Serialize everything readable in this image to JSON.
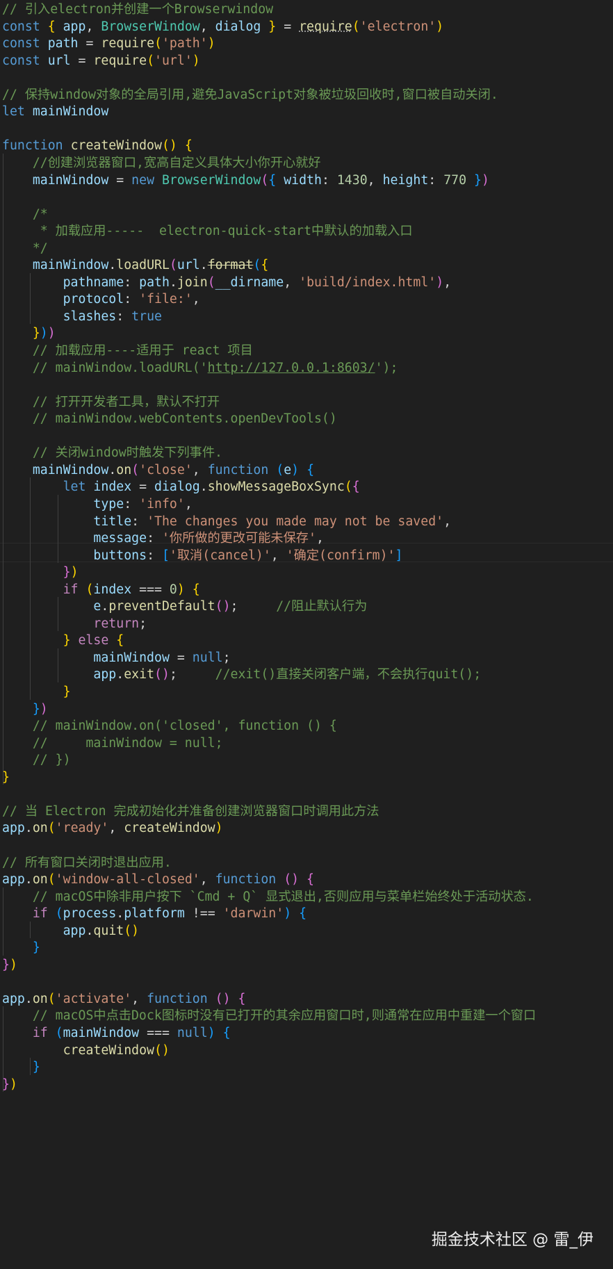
{
  "editor": {
    "background": "#1f1f1f",
    "lines": [
      [
        [
          "comment",
          "// 引入electron并创建一个Browserwindow"
        ]
      ],
      [
        [
          "keyword",
          "const"
        ],
        [
          "plain",
          " "
        ],
        [
          "b1",
          "{"
        ],
        [
          "plain",
          " "
        ],
        [
          "variable",
          "app"
        ],
        [
          "plain",
          ", "
        ],
        [
          "class",
          "BrowserWindow"
        ],
        [
          "plain",
          ", "
        ],
        [
          "variable",
          "dialog"
        ],
        [
          "plain",
          " "
        ],
        [
          "b1",
          "}"
        ],
        [
          "plain",
          " = "
        ],
        [
          "hint",
          "require"
        ],
        [
          "b1",
          "("
        ],
        [
          "string",
          "'electron'"
        ],
        [
          "b1",
          ")"
        ]
      ],
      [
        [
          "keyword",
          "const"
        ],
        [
          "plain",
          " "
        ],
        [
          "variable",
          "path"
        ],
        [
          "plain",
          " = "
        ],
        [
          "function",
          "require"
        ],
        [
          "b1",
          "("
        ],
        [
          "string",
          "'path'"
        ],
        [
          "b1",
          ")"
        ]
      ],
      [
        [
          "keyword",
          "const"
        ],
        [
          "plain",
          " "
        ],
        [
          "variable",
          "url"
        ],
        [
          "plain",
          " = "
        ],
        [
          "function",
          "require"
        ],
        [
          "b1",
          "("
        ],
        [
          "string",
          "'url'"
        ],
        [
          "b1",
          ")"
        ]
      ],
      [],
      [
        [
          "comment",
          "// 保持window对象的全局引用,避免JavaScript对象被垃圾回收时,窗口被自动关闭."
        ]
      ],
      [
        [
          "keyword",
          "let"
        ],
        [
          "plain",
          " "
        ],
        [
          "variable",
          "mainWindow"
        ]
      ],
      [],
      [
        [
          "keyword",
          "function"
        ],
        [
          "plain",
          " "
        ],
        [
          "function",
          "createWindow"
        ],
        [
          "b1",
          "()"
        ],
        [
          "plain",
          " "
        ],
        [
          "b1",
          "{"
        ]
      ],
      [
        [
          "plain",
          "    "
        ],
        [
          "comment",
          "//创建浏览器窗口,宽高自定义具体大小你开心就好"
        ]
      ],
      [
        [
          "plain",
          "    "
        ],
        [
          "variable",
          "mainWindow"
        ],
        [
          "plain",
          " = "
        ],
        [
          "keyword",
          "new"
        ],
        [
          "plain",
          " "
        ],
        [
          "class",
          "BrowserWindow"
        ],
        [
          "b2",
          "("
        ],
        [
          "b3",
          "{"
        ],
        [
          "plain",
          " "
        ],
        [
          "variable",
          "width"
        ],
        [
          "plain",
          ": "
        ],
        [
          "number",
          "1430"
        ],
        [
          "plain",
          ", "
        ],
        [
          "variable",
          "height"
        ],
        [
          "plain",
          ": "
        ],
        [
          "number",
          "770"
        ],
        [
          "plain",
          " "
        ],
        [
          "b3",
          "}"
        ],
        [
          "b2",
          ")"
        ]
      ],
      [],
      [
        [
          "plain",
          "    "
        ],
        [
          "comment",
          "/*"
        ]
      ],
      [
        [
          "plain",
          "    "
        ],
        [
          "comment",
          " * 加载应用-----  electron-quick-start中默认的加载入口"
        ]
      ],
      [
        [
          "plain",
          "    "
        ],
        [
          "comment",
          "*/"
        ]
      ],
      [
        [
          "plain",
          "    "
        ],
        [
          "variable",
          "mainWindow"
        ],
        [
          "plain",
          "."
        ],
        [
          "function",
          "loadURL"
        ],
        [
          "b2",
          "("
        ],
        [
          "variable",
          "url"
        ],
        [
          "plain",
          "."
        ],
        [
          "deprecated",
          "format"
        ],
        [
          "b3",
          "("
        ],
        [
          "b1",
          "{"
        ]
      ],
      [
        [
          "plain",
          "        "
        ],
        [
          "variable",
          "pathname"
        ],
        [
          "plain",
          ": "
        ],
        [
          "variable",
          "path"
        ],
        [
          "plain",
          "."
        ],
        [
          "function",
          "join"
        ],
        [
          "b2",
          "("
        ],
        [
          "variable",
          "__dirname"
        ],
        [
          "plain",
          ", "
        ],
        [
          "string",
          "'build/index.html'"
        ],
        [
          "b2",
          ")"
        ],
        [
          "plain",
          ","
        ]
      ],
      [
        [
          "plain",
          "        "
        ],
        [
          "variable",
          "protocol"
        ],
        [
          "plain",
          ": "
        ],
        [
          "string",
          "'file:'"
        ],
        [
          "plain",
          ","
        ]
      ],
      [
        [
          "plain",
          "        "
        ],
        [
          "variable",
          "slashes"
        ],
        [
          "plain",
          ": "
        ],
        [
          "keyword",
          "true"
        ]
      ],
      [
        [
          "plain",
          "    "
        ],
        [
          "b1",
          "}"
        ],
        [
          "b3",
          ")"
        ],
        [
          "b2",
          ")"
        ]
      ],
      [
        [
          "plain",
          "    "
        ],
        [
          "comment",
          "// 加载应用----适用于 react 项目"
        ]
      ],
      [
        [
          "plain",
          "    "
        ],
        [
          "comment",
          "// mainWindow.loadURL('"
        ],
        [
          "link",
          "http://127.0.0.1:8603/"
        ],
        [
          "comment",
          "');"
        ]
      ],
      [],
      [
        [
          "plain",
          "    "
        ],
        [
          "comment",
          "// 打开开发者工具，默认不打开"
        ]
      ],
      [
        [
          "plain",
          "    "
        ],
        [
          "comment",
          "// mainWindow.webContents.openDevTools()"
        ]
      ],
      [],
      [
        [
          "plain",
          "    "
        ],
        [
          "comment",
          "// 关闭window时触发下列事件."
        ]
      ],
      [
        [
          "plain",
          "    "
        ],
        [
          "variable",
          "mainWindow"
        ],
        [
          "plain",
          "."
        ],
        [
          "function",
          "on"
        ],
        [
          "b2",
          "("
        ],
        [
          "string",
          "'close'"
        ],
        [
          "plain",
          ", "
        ],
        [
          "keyword",
          "function"
        ],
        [
          "plain",
          " "
        ],
        [
          "b3",
          "("
        ],
        [
          "variable",
          "e"
        ],
        [
          "b3",
          ")"
        ],
        [
          "plain",
          " "
        ],
        [
          "b3",
          "{"
        ]
      ],
      [
        [
          "plain",
          "        "
        ],
        [
          "keyword",
          "let"
        ],
        [
          "plain",
          " "
        ],
        [
          "variable",
          "index"
        ],
        [
          "plain",
          " = "
        ],
        [
          "variable",
          "dialog"
        ],
        [
          "plain",
          "."
        ],
        [
          "function",
          "showMessageBoxSync"
        ],
        [
          "b1",
          "("
        ],
        [
          "b2",
          "{"
        ]
      ],
      [
        [
          "plain",
          "            "
        ],
        [
          "variable",
          "type"
        ],
        [
          "plain",
          ": "
        ],
        [
          "string",
          "'info'"
        ],
        [
          "plain",
          ","
        ]
      ],
      [
        [
          "plain",
          "            "
        ],
        [
          "variable",
          "title"
        ],
        [
          "plain",
          ": "
        ],
        [
          "string",
          "'The changes you made may not be saved'"
        ],
        [
          "plain",
          ","
        ]
      ],
      [
        [
          "plain",
          "            "
        ],
        [
          "variable",
          "message"
        ],
        [
          "plain",
          ": "
        ],
        [
          "string",
          "'你所做的更改可能未保存'"
        ],
        [
          "plain",
          ","
        ]
      ],
      [
        [
          "plain",
          "            "
        ],
        [
          "variable",
          "buttons"
        ],
        [
          "plain",
          ": "
        ],
        [
          "b3",
          "["
        ],
        [
          "string",
          "'取消(cancel)'"
        ],
        [
          "plain",
          ", "
        ],
        [
          "string",
          "'确定(confirm)'"
        ],
        [
          "b3",
          "]"
        ]
      ],
      [
        [
          "plain",
          "        "
        ],
        [
          "b2",
          "}"
        ],
        [
          "b1",
          ")"
        ]
      ],
      [
        [
          "plain",
          "        "
        ],
        [
          "control",
          "if"
        ],
        [
          "plain",
          " "
        ],
        [
          "b1",
          "("
        ],
        [
          "variable",
          "index"
        ],
        [
          "plain",
          " === "
        ],
        [
          "number",
          "0"
        ],
        [
          "b1",
          ")"
        ],
        [
          "plain",
          " "
        ],
        [
          "b1",
          "{"
        ]
      ],
      [
        [
          "plain",
          "            "
        ],
        [
          "variable",
          "e"
        ],
        [
          "plain",
          "."
        ],
        [
          "function",
          "preventDefault"
        ],
        [
          "b2",
          "()"
        ],
        [
          "plain",
          ";     "
        ],
        [
          "comment",
          "//阻止默认行为"
        ]
      ],
      [
        [
          "plain",
          "            "
        ],
        [
          "control",
          "return"
        ],
        [
          "plain",
          ";"
        ]
      ],
      [
        [
          "plain",
          "        "
        ],
        [
          "b1",
          "}"
        ],
        [
          "plain",
          " "
        ],
        [
          "control",
          "else"
        ],
        [
          "plain",
          " "
        ],
        [
          "b1",
          "{"
        ]
      ],
      [
        [
          "plain",
          "            "
        ],
        [
          "variable",
          "mainWindow"
        ],
        [
          "plain",
          " = "
        ],
        [
          "keyword",
          "null"
        ],
        [
          "plain",
          ";"
        ]
      ],
      [
        [
          "plain",
          "            "
        ],
        [
          "variable",
          "app"
        ],
        [
          "plain",
          "."
        ],
        [
          "function",
          "exit"
        ],
        [
          "b2",
          "()"
        ],
        [
          "plain",
          ";     "
        ],
        [
          "comment",
          "//exit()直接关闭客户端，不会执行quit();"
        ]
      ],
      [
        [
          "plain",
          "        "
        ],
        [
          "b1",
          "}"
        ]
      ],
      [
        [
          "plain",
          "    "
        ],
        [
          "b3",
          "}"
        ],
        [
          "b2",
          ")"
        ]
      ],
      [
        [
          "plain",
          "    "
        ],
        [
          "comment",
          "// mainWindow.on('closed', function () {"
        ]
      ],
      [
        [
          "plain",
          "    "
        ],
        [
          "comment",
          "//     mainWindow = null;"
        ]
      ],
      [
        [
          "plain",
          "    "
        ],
        [
          "comment",
          "// })"
        ]
      ],
      [
        [
          "b1",
          "}"
        ]
      ],
      [],
      [
        [
          "comment",
          "// 当 Electron 完成初始化并准备创建浏览器窗口时调用此方法"
        ]
      ],
      [
        [
          "variable",
          "app"
        ],
        [
          "plain",
          "."
        ],
        [
          "function",
          "on"
        ],
        [
          "b1",
          "("
        ],
        [
          "string",
          "'ready'"
        ],
        [
          "plain",
          ", "
        ],
        [
          "function",
          "createWindow"
        ],
        [
          "b1",
          ")"
        ]
      ],
      [],
      [
        [
          "comment",
          "// 所有窗口关闭时退出应用."
        ]
      ],
      [
        [
          "variable",
          "app"
        ],
        [
          "plain",
          "."
        ],
        [
          "function",
          "on"
        ],
        [
          "b1",
          "("
        ],
        [
          "string",
          "'window-all-closed'"
        ],
        [
          "plain",
          ", "
        ],
        [
          "keyword",
          "function"
        ],
        [
          "plain",
          " "
        ],
        [
          "b2",
          "()"
        ],
        [
          "plain",
          " "
        ],
        [
          "b2",
          "{"
        ]
      ],
      [
        [
          "plain",
          "    "
        ],
        [
          "comment",
          "// macOS中除非用户按下 `Cmd + Q` 显式退出,否则应用与菜单栏始终处于活动状态."
        ]
      ],
      [
        [
          "plain",
          "    "
        ],
        [
          "control",
          "if"
        ],
        [
          "plain",
          " "
        ],
        [
          "b3",
          "("
        ],
        [
          "variable",
          "process"
        ],
        [
          "plain",
          "."
        ],
        [
          "variable",
          "platform"
        ],
        [
          "plain",
          " !== "
        ],
        [
          "string",
          "'darwin'"
        ],
        [
          "b3",
          ")"
        ],
        [
          "plain",
          " "
        ],
        [
          "b3",
          "{"
        ]
      ],
      [
        [
          "plain",
          "        "
        ],
        [
          "variable",
          "app"
        ],
        [
          "plain",
          "."
        ],
        [
          "function",
          "quit"
        ],
        [
          "b1",
          "()"
        ]
      ],
      [
        [
          "plain",
          "    "
        ],
        [
          "b3",
          "}"
        ]
      ],
      [
        [
          "b2",
          "}"
        ],
        [
          "b1",
          ")"
        ]
      ],
      [],
      [
        [
          "variable",
          "app"
        ],
        [
          "plain",
          "."
        ],
        [
          "function",
          "on"
        ],
        [
          "b1",
          "("
        ],
        [
          "string",
          "'activate'"
        ],
        [
          "plain",
          ", "
        ],
        [
          "keyword",
          "function"
        ],
        [
          "plain",
          " "
        ],
        [
          "b2",
          "()"
        ],
        [
          "plain",
          " "
        ],
        [
          "b2",
          "{"
        ]
      ],
      [
        [
          "plain",
          "    "
        ],
        [
          "comment",
          "// macOS中点击Dock图标时没有已打开的其余应用窗口时,则通常在应用中重建一个窗口"
        ]
      ],
      [
        [
          "plain",
          "    "
        ],
        [
          "control",
          "if"
        ],
        [
          "plain",
          " "
        ],
        [
          "b3",
          "("
        ],
        [
          "variable",
          "mainWindow"
        ],
        [
          "plain",
          " === "
        ],
        [
          "keyword",
          "null"
        ],
        [
          "b3",
          ")"
        ],
        [
          "plain",
          " "
        ],
        [
          "b3",
          "{"
        ]
      ],
      [
        [
          "plain",
          "        "
        ],
        [
          "function",
          "createWindow"
        ],
        [
          "b1",
          "()"
        ]
      ],
      [
        [
          "plain",
          "    "
        ],
        [
          "b3",
          "}"
        ]
      ],
      [
        [
          "b2",
          "}"
        ],
        [
          "b1",
          ")"
        ]
      ]
    ]
  },
  "watermark": {
    "text": "掘金技术社区 @ 雷_伊"
  }
}
